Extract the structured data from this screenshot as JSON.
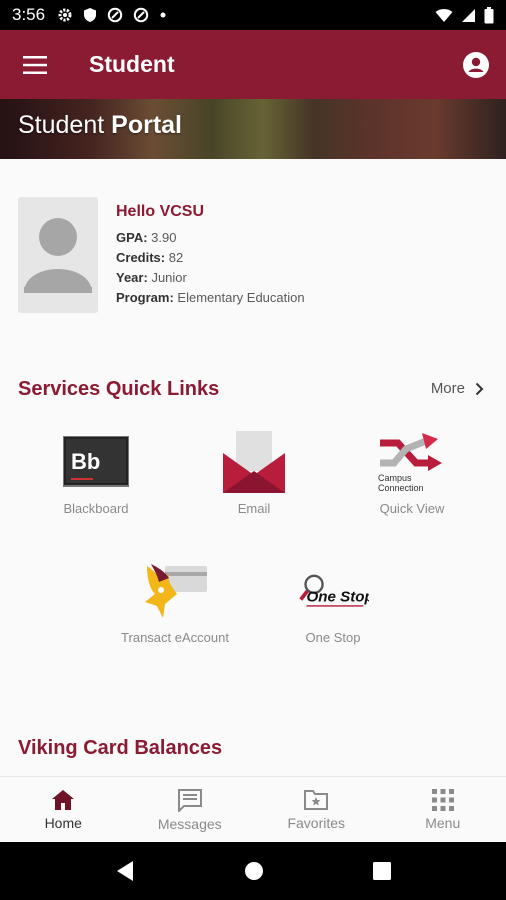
{
  "status": {
    "time": "3:56"
  },
  "appbar": {
    "title": "Student"
  },
  "banner": {
    "title_light": "Student ",
    "title_bold": "Portal"
  },
  "profile": {
    "greeting": "Hello VCSU",
    "rows": [
      {
        "label": "GPA:",
        "value": "3.90"
      },
      {
        "label": "Credits:",
        "value": "82"
      },
      {
        "label": "Year:",
        "value": "Junior"
      },
      {
        "label": "Program:",
        "value": "Elementary Education"
      }
    ]
  },
  "services": {
    "title": "Services Quick Links",
    "more": "More",
    "tiles": [
      {
        "label": "Blackboard",
        "icon": "blackboard-icon",
        "text": "Bb"
      },
      {
        "label": "Email",
        "icon": "email-icon"
      },
      {
        "label": "Quick View",
        "icon": "campus-connection-icon",
        "text1": "Campus",
        "text2": "Connection"
      },
      {
        "label": "Transact eAccount",
        "icon": "viking-card-icon"
      },
      {
        "label": "One Stop",
        "icon": "one-stop-icon",
        "text": "One Stop"
      }
    ]
  },
  "viking": {
    "title": "Viking Card Balances"
  },
  "nav": {
    "items": [
      {
        "label": "Home",
        "icon": "home-icon"
      },
      {
        "label": "Messages",
        "icon": "messages-icon"
      },
      {
        "label": "Favorites",
        "icon": "favorites-icon"
      },
      {
        "label": "Menu",
        "icon": "grid-icon"
      }
    ]
  },
  "colors": {
    "brand": "#8b1b33",
    "statusbar": "#000000"
  }
}
